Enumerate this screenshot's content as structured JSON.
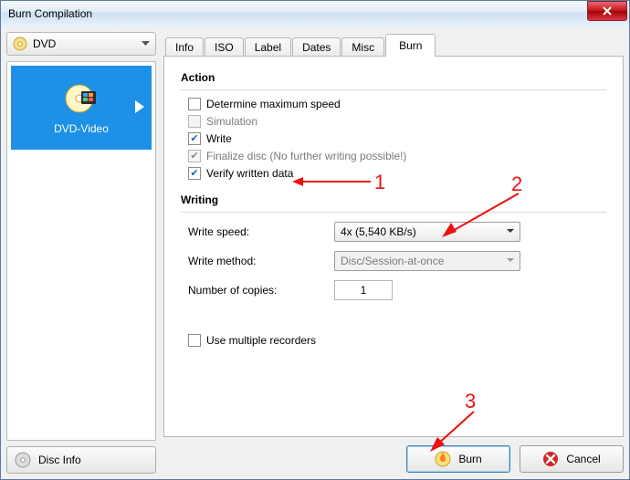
{
  "window": {
    "title": "Burn Compilation"
  },
  "left": {
    "media_type": "DVD",
    "card_label": "DVD-Video",
    "disc_info": "Disc Info"
  },
  "tabs": [
    "Info",
    "ISO",
    "Label",
    "Dates",
    "Misc",
    "Burn"
  ],
  "active_tab": 5,
  "action": {
    "title": "Action",
    "determine": "Determine maximum speed",
    "simulation": "Simulation",
    "write": "Write",
    "finalize": "Finalize disc (No further writing possible!)",
    "verify": "Verify written data"
  },
  "writing": {
    "title": "Writing",
    "speed_label": "Write speed:",
    "speed_value": "4x (5,540 KB/s)",
    "method_label": "Write method:",
    "method_value": "Disc/Session-at-once",
    "copies_label": "Number of copies:",
    "copies_value": "1",
    "multi_label": "Use multiple recorders"
  },
  "buttons": {
    "burn": "Burn",
    "cancel": "Cancel"
  },
  "annotations": {
    "a1": "1",
    "a2": "2",
    "a3": "3"
  }
}
